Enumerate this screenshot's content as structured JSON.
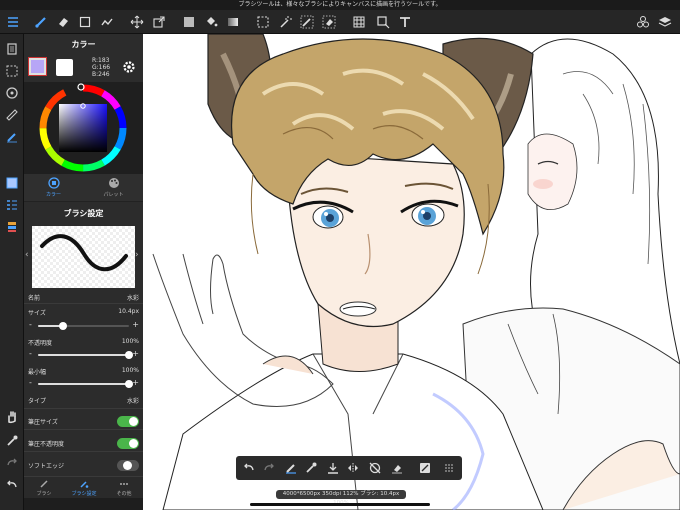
{
  "status_bar": {
    "hint": "ブラシツールは、様々なブラシによりキャンバスに描画を行うツールです。"
  },
  "toolbar": {
    "icons": [
      "menu-icon",
      "brush-icon",
      "eraser-icon",
      "rectangle-icon",
      "fill-tool-icon",
      "move-icon",
      "transform-icon",
      "color-square-icon",
      "bucket-icon",
      "gradient-icon",
      "select-icon",
      "magic-wand-icon",
      "select-pen-icon",
      "select-eraser-icon",
      "grid-icon",
      "crop-icon",
      "text-icon",
      "materials-icon",
      "layers-icon"
    ]
  },
  "color_panel": {
    "title": "カラー",
    "main_color": "#B7A6F6",
    "sub_color": "#FFFFFF",
    "rgb": {
      "r": "R:183",
      "g": "G:166",
      "b": "B:246"
    },
    "tabs": [
      {
        "label": "カラー",
        "active": true
      },
      {
        "label": "パレット",
        "active": false
      }
    ]
  },
  "brush_panel": {
    "title": "ブラシ設定",
    "name_label": "名前",
    "name_value": "水彩",
    "size_label": "サイズ",
    "size_value": "10.4px",
    "size_level": 0.28,
    "opacity_label": "不透明度",
    "opacity_value": "100%",
    "opacity_level": 1.0,
    "min_width_label": "最小幅",
    "min_width_value": "100%",
    "min_width_level": 1.0,
    "type_label": "タイプ",
    "type_value": "水彩",
    "pen_size_label": "筆圧サイズ",
    "pen_size_on": true,
    "pen_opacity_label": "筆圧不透明度",
    "pen_opacity_on": true,
    "soft_edge_label": "ソフトエッジ",
    "soft_edge_on": false,
    "minus": "-",
    "plus": "+",
    "prev_arrow": "‹",
    "next_arrow": "›"
  },
  "panel_bottom_tabs": [
    {
      "label": "ブラシ",
      "active": false
    },
    {
      "label": "ブラシ設定",
      "active": true
    },
    {
      "label": "その他",
      "active": false
    }
  ],
  "info_bar": {
    "text": "4000*6500px 350dpi 112% ブラシ: 10.4px 100%"
  },
  "colors": {
    "accent": "#4DA3FF",
    "toggle_on": "#4AB54A",
    "panel_bg": "#2C2C2C"
  }
}
